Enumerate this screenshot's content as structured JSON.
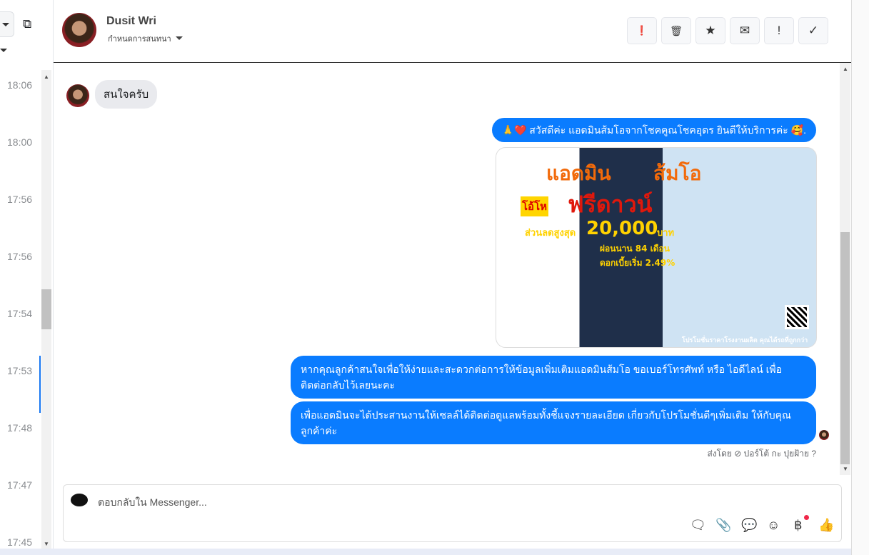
{
  "sidebar": {
    "times": [
      "18:06",
      "18:00",
      "17:56",
      "17:56",
      "17:54",
      "17:53",
      "17:48",
      "17:47",
      "17:45"
    ]
  },
  "header": {
    "name": "Dusit Wri",
    "subtitle": "กำหนดการสนทนา"
  },
  "toolbar": {
    "buttons": [
      {
        "icon": "alert-circle-icon",
        "glyph": "❗"
      },
      {
        "icon": "trash-icon",
        "glyph": "🗑"
      },
      {
        "icon": "star-icon",
        "glyph": "★"
      },
      {
        "icon": "envelope-icon",
        "glyph": "✉"
      },
      {
        "icon": "exclamation-icon",
        "glyph": "!"
      },
      {
        "icon": "check-icon",
        "glyph": "✓"
      }
    ]
  },
  "messages": {
    "incoming": "สนใจครับ",
    "greeting": "🙏❤️ สวัสดีค่ะ แอดมินส้มโอจากโชคคูณโชคอุดร ยินดีให้บริการค่ะ 🥰.",
    "promo": {
      "title1": "แอดมิน",
      "title2": "ส้มโอ",
      "badge": "โอ้โห",
      "headline": "ฟรีดาวน์",
      "discount_label": "ส่วนลดสูงสุด",
      "discount": "20,000",
      "currency": "บาท",
      "installment": "ผ่อนนาน 84 เดือน",
      "interest": "ดอกเบี้ยเริ่ม 2.49%",
      "footer": "โปรโมชั่นราคาโรงงานผลิต คุณได้รถที่ถูกกว่า"
    },
    "msg2": "หากคุณลูกค้าสนใจเพื่อให้ง่ายและสะดวกต่อการให้ข้อมูลเพิ่มเติมแอดมินส้มโอ ขอเบอร์โทรศัพท์ หรือ ไอดีไลน์ เพื่อติดต่อกลับไว้เลยนะคะ",
    "msg3": "เพื่อแอดมินจะได้ประสานงานให้เซลล์ได้ติดต่อดูแลพร้อมทั้งชี้แจงรายละเอียด เกี่ยวกับโปรโมชั่นดีๆเพิ่มเติม ให้กับคุณลูกค้าค่ะ",
    "sent_by": "ส่งโดย ⊘ ปอร์โต้ กะ ปุยฝ้าย ?"
  },
  "composer": {
    "placeholder": "ตอบกลับใน Messenger..."
  },
  "colors": {
    "accent": "#0a7cff",
    "incoming": "#e9eaee"
  }
}
